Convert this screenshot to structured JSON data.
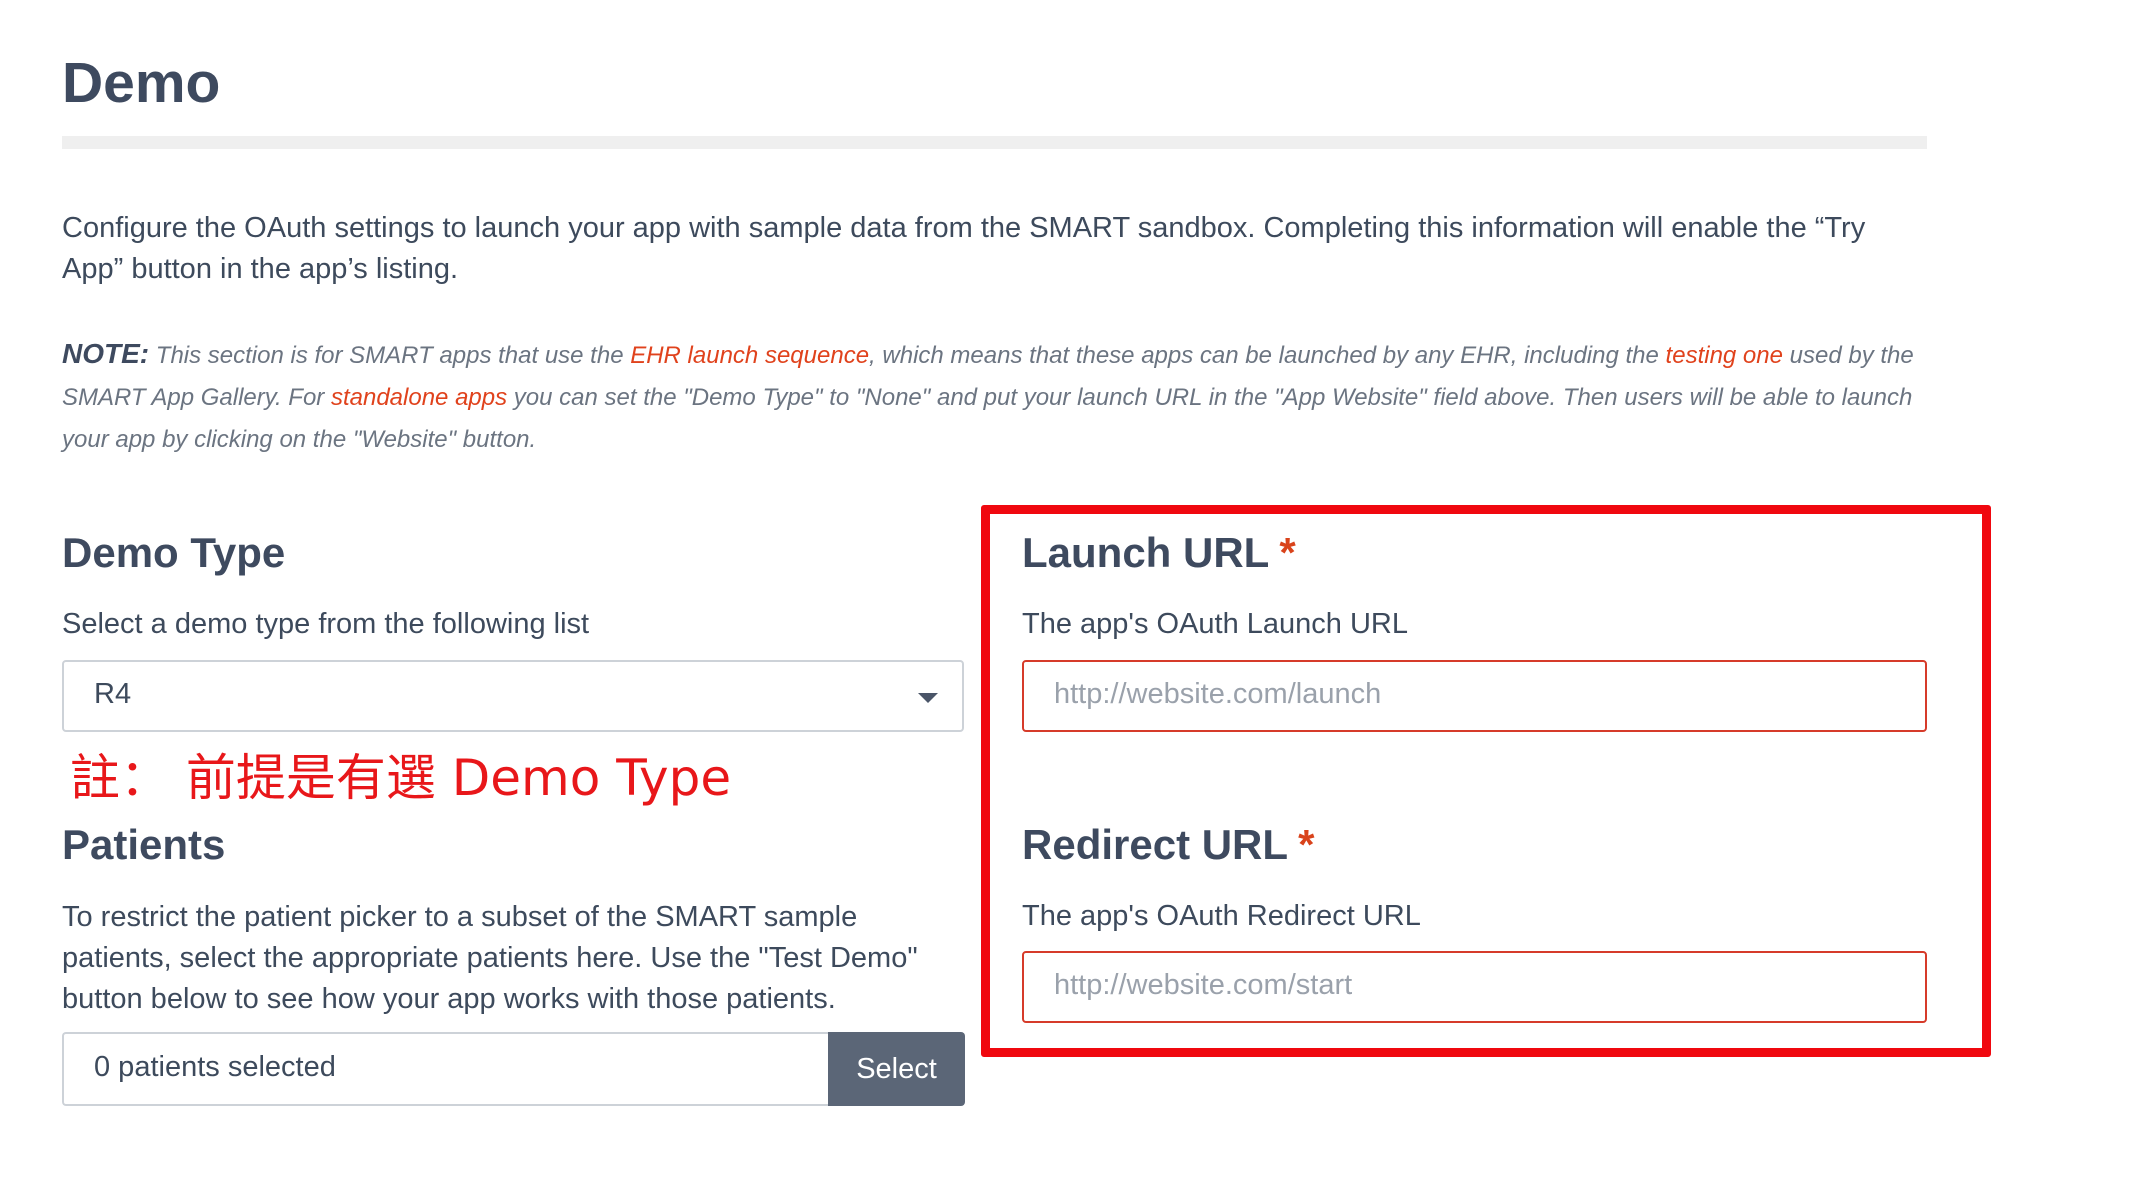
{
  "section": {
    "title": "Demo",
    "description": "Configure the OAuth settings to launch your app with sample data from the SMART sandbox. Completing this information will enable the “Try App” button in the app’s listing.",
    "note": {
      "label": "NOTE:",
      "text_1": " This section is for SMART apps that use the ",
      "link_1": "EHR launch sequence",
      "text_2": ", which means that these apps can be launched by any EHR, including the ",
      "link_2": "testing one",
      "text_3": " used by the SMART App Gallery. For ",
      "link_3": "standalone apps",
      "text_4": " you can set the \"Demo Type\" to \"None\" and put your launch URL in the \"App Website\" field above. Then users will be able to launch your app by clicking on the \"Website\" button."
    }
  },
  "demo_type": {
    "heading": "Demo Type",
    "help": "Select a demo type from the following list",
    "selected": "R4"
  },
  "annotation": "註： 前提是有選 Demo Type",
  "patients": {
    "heading": "Patients",
    "help": "To restrict the patient picker to a subset of the SMART sample patients, select the appropriate patients here. Use the \"Test Demo\" button below to see how your app works with those patients.",
    "value": "0 patients selected",
    "button": "Select"
  },
  "launch_url": {
    "heading": "Launch URL",
    "required_mark": "*",
    "help": "The app's OAuth Launch URL",
    "placeholder": "http://website.com/launch"
  },
  "redirect_url": {
    "heading": "Redirect URL",
    "required_mark": "*",
    "help": "The app's OAuth Redirect URL",
    "placeholder": "http://website.com/start"
  },
  "colors": {
    "heading": "#3e4a5f",
    "link": "#e0421c",
    "annotation_red": "#f0080f",
    "button_bg": "#5b6677"
  }
}
